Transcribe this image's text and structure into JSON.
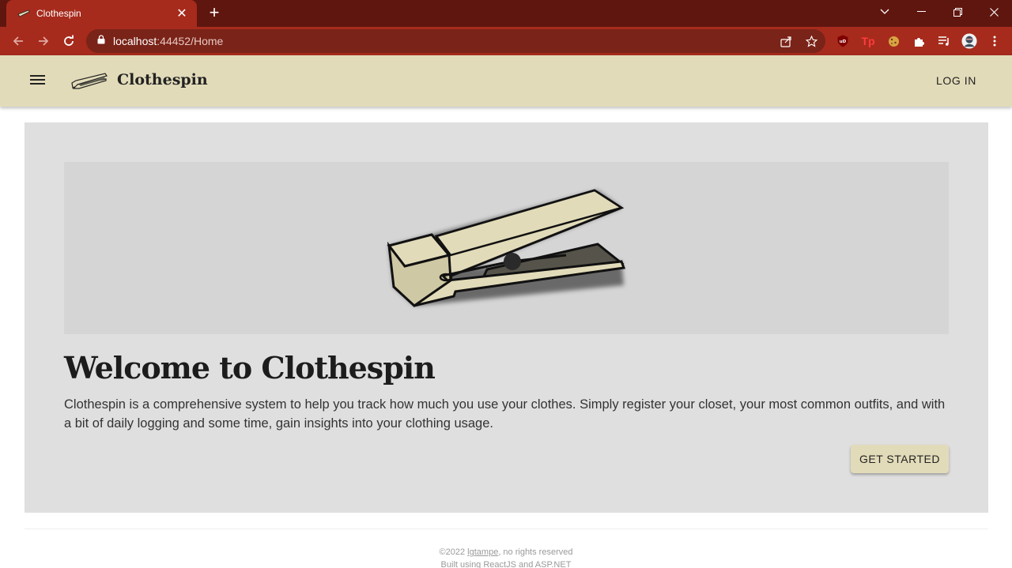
{
  "browser": {
    "tab_title": "Clothespin",
    "url_host": "localhost",
    "url_rest": ":44452/Home",
    "extensions": [
      "ublock-icon",
      "tp-icon",
      "cookie-icon",
      "puzzle-icon",
      "media-icon",
      "profile-avatar"
    ]
  },
  "appbar": {
    "brand": "Clothespin",
    "login_label": "LOG IN"
  },
  "hero": {
    "headline": "Welcome to Clothespin",
    "description": "Clothespin is a comprehensive system to help you track how much you use your clothes. Simply register your closet, your most common outfits, and with a bit of daily logging and some time, gain insights into your clothing usage.",
    "cta_label": "GET STARTED"
  },
  "footer": {
    "copyright_prefix": "©2022 ",
    "author": "lgtampe",
    "copyright_suffix": ", no rights reserved",
    "built_with": "Built using ReactJS and ASP.NET"
  },
  "colors": {
    "chrome_dark": "#5f160f",
    "chrome_accent": "#a62b1d",
    "appbar": "#e2dbb9",
    "hero_bg": "#dfdfdf"
  }
}
